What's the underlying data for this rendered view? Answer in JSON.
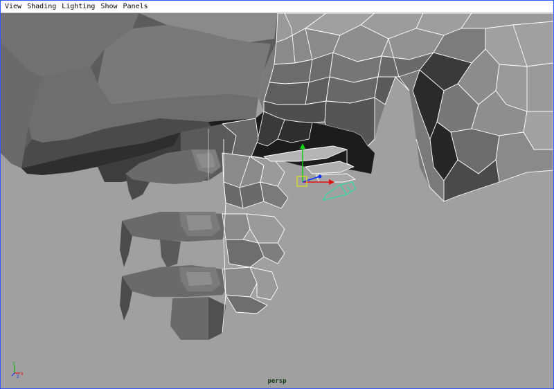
{
  "menubar": {
    "items": [
      {
        "label": "View"
      },
      {
        "label": "Shading"
      },
      {
        "label": "Lighting"
      },
      {
        "label": "Show"
      },
      {
        "label": "Panels"
      }
    ]
  },
  "viewport": {
    "camera": "persp",
    "axis": {
      "x": "X",
      "y": "Y",
      "z": "Z"
    }
  },
  "colors": {
    "background": "#a0a0a0",
    "wire": "#ffffff",
    "selected": "#33e0a8",
    "manip_x": "#e01010",
    "manip_y": "#10d010",
    "manip_z": "#1030ff",
    "frame": "#2a5cff",
    "pivot": "#e0e020"
  }
}
